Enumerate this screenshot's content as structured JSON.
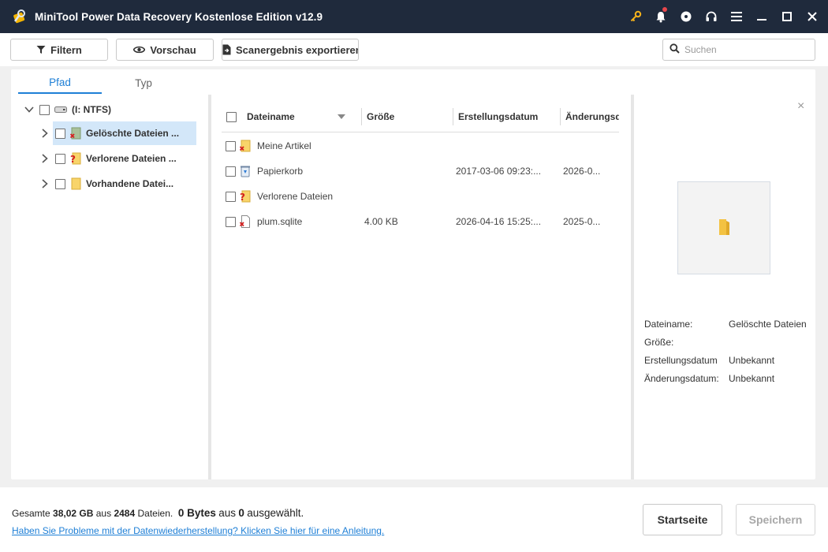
{
  "window": {
    "title": "MiniTool Power Data Recovery Kostenlose Edition v12.9",
    "icons": [
      "key-icon",
      "bell-icon",
      "disc-icon",
      "headset-icon",
      "menu-icon",
      "minimize-icon",
      "maximize-icon",
      "close-icon"
    ],
    "accent_color": "#1e7fd6",
    "titlebar_color": "#1f2a3c"
  },
  "toolbar": {
    "filter_label": "Filtern",
    "preview_label": "Vorschau",
    "export_label": "Scanergebnis exportieren",
    "search_placeholder": "Suchen"
  },
  "tabs": [
    {
      "label": "Pfad",
      "active": true
    },
    {
      "label": "Typ",
      "active": false
    }
  ],
  "tree": {
    "root": "(I: NTFS)",
    "items": [
      {
        "label": "Gelöschte Dateien ...",
        "icon": "deleted-folder-icon",
        "selected": true
      },
      {
        "label": "Verlorene Dateien ...",
        "icon": "lost-folder-icon",
        "selected": false
      },
      {
        "label": "Vorhandene Datei...",
        "icon": "folder-icon",
        "selected": false
      }
    ]
  },
  "list": {
    "columns": [
      "Dateiname",
      "Größe",
      "Erstellungsdatum",
      "Änderungsdatum"
    ],
    "rows": [
      {
        "name": "Meine Artikel",
        "icon": "deleted-folder-icon",
        "size": "",
        "created": "",
        "modified": ""
      },
      {
        "name": "Papierkorb",
        "icon": "recycle-bin-icon",
        "size": "",
        "created": "2017-03-06 09:23:...",
        "modified": "2026-0..."
      },
      {
        "name": "Verlorene Dateien",
        "icon": "lost-folder-icon",
        "size": "",
        "created": "",
        "modified": ""
      },
      {
        "name": "plum.sqlite",
        "icon": "deleted-file-icon",
        "size": "4.00 KB",
        "created": "2026-04-16 15:25:...",
        "modified": "2025-0..."
      }
    ]
  },
  "preview": {
    "fields": [
      {
        "key": "Dateiname:",
        "value": "Gelöschte Dateien"
      },
      {
        "key": "Größe:",
        "value": ""
      },
      {
        "key": "Erstellungsdatum",
        "value": "Unbekannt"
      },
      {
        "key": "Änderungsdatum:",
        "value": "Unbekannt"
      }
    ]
  },
  "footer": {
    "total_prefix": "Gesamte",
    "total_size": "38,02 GB",
    "from": "aus",
    "total_files": "2484",
    "files_word": "Dateien.",
    "selected_size": "0 Bytes",
    "from2": "aus",
    "selected_count": "0",
    "selected_word": "ausgewählt.",
    "help_link": "Haben Sie Probleme mit der Datenwiederherstellung? Klicken Sie hier für eine Anleitung.",
    "home_button": "Startseite",
    "save_button": "Speichern"
  }
}
